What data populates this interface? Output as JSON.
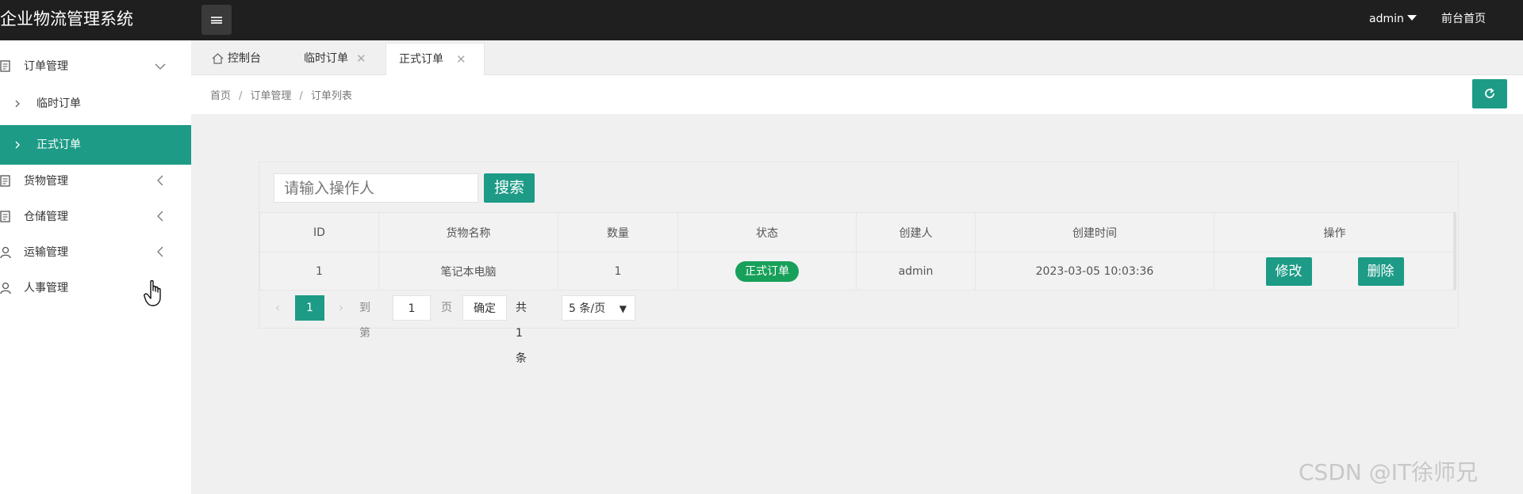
{
  "header": {
    "app_title": "企业物流管理系统",
    "user": "admin",
    "front_link": "前台首页"
  },
  "sidebar": {
    "items": [
      {
        "label": "订单管理",
        "icon": "document-icon",
        "arrow": "chevron-down-icon"
      },
      {
        "label": "临时订单",
        "icon": "chevron-right-icon"
      },
      {
        "label": "正式订单",
        "icon": "chevron-right-icon",
        "active": true
      },
      {
        "label": "货物管理",
        "icon": "document-icon",
        "arrow": "chevron-left-icon"
      },
      {
        "label": "仓储管理",
        "icon": "document-icon",
        "arrow": "chevron-left-icon"
      },
      {
        "label": "运输管理",
        "icon": "user-icon",
        "arrow": "chevron-left-icon"
      },
      {
        "label": "人事管理",
        "icon": "user-icon"
      }
    ]
  },
  "tabs": [
    {
      "label": "控制台",
      "icon": "home-icon"
    },
    {
      "label": "临时订单",
      "closable": true
    },
    {
      "label": "正式订单",
      "closable": true,
      "active": true
    }
  ],
  "breadcrumb": [
    "首页",
    "订单管理",
    "订单列表"
  ],
  "search": {
    "placeholder": "请输入操作人",
    "button": "搜索"
  },
  "table": {
    "columns": [
      "ID",
      "货物名称",
      "数量",
      "状态",
      "创建人",
      "创建时间",
      "操作"
    ],
    "rows": [
      {
        "id": "1",
        "name": "笔记本电脑",
        "qty": "1",
        "status": "正式订单",
        "creator": "admin",
        "created": "2023-03-05 10:03:36",
        "edit": "修改",
        "delete": "删除"
      }
    ]
  },
  "pager": {
    "current": "1",
    "goto_label": "到第",
    "page_input": "1",
    "page_unit": "页",
    "confirm": "确定",
    "total": "共 1 条",
    "page_size": "5 条/页"
  },
  "watermark": "CSDN @IT徐师兄",
  "colors": {
    "accent": "#1d9b86",
    "header_bg": "#1f1f1f",
    "status_green": "#17a05a"
  }
}
